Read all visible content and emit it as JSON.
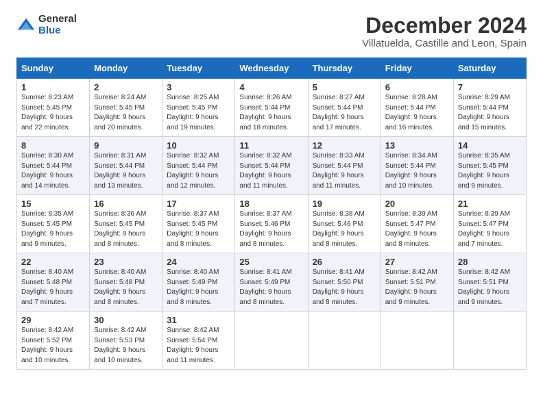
{
  "logo": {
    "general": "General",
    "blue": "Blue"
  },
  "title": "December 2024",
  "subtitle": "Villatuelda, Castille and Leon, Spain",
  "headers": [
    "Sunday",
    "Monday",
    "Tuesday",
    "Wednesday",
    "Thursday",
    "Friday",
    "Saturday"
  ],
  "weeks": [
    [
      {
        "day": "1",
        "sunrise": "Sunrise: 8:23 AM",
        "sunset": "Sunset: 5:45 PM",
        "daylight": "Daylight: 9 hours and 22 minutes."
      },
      {
        "day": "2",
        "sunrise": "Sunrise: 8:24 AM",
        "sunset": "Sunset: 5:45 PM",
        "daylight": "Daylight: 9 hours and 20 minutes."
      },
      {
        "day": "3",
        "sunrise": "Sunrise: 8:25 AM",
        "sunset": "Sunset: 5:45 PM",
        "daylight": "Daylight: 9 hours and 19 minutes."
      },
      {
        "day": "4",
        "sunrise": "Sunrise: 8:26 AM",
        "sunset": "Sunset: 5:44 PM",
        "daylight": "Daylight: 9 hours and 18 minutes."
      },
      {
        "day": "5",
        "sunrise": "Sunrise: 8:27 AM",
        "sunset": "Sunset: 5:44 PM",
        "daylight": "Daylight: 9 hours and 17 minutes."
      },
      {
        "day": "6",
        "sunrise": "Sunrise: 8:28 AM",
        "sunset": "Sunset: 5:44 PM",
        "daylight": "Daylight: 9 hours and 16 minutes."
      },
      {
        "day": "7",
        "sunrise": "Sunrise: 8:29 AM",
        "sunset": "Sunset: 5:44 PM",
        "daylight": "Daylight: 9 hours and 15 minutes."
      }
    ],
    [
      {
        "day": "8",
        "sunrise": "Sunrise: 8:30 AM",
        "sunset": "Sunset: 5:44 PM",
        "daylight": "Daylight: 9 hours and 14 minutes."
      },
      {
        "day": "9",
        "sunrise": "Sunrise: 8:31 AM",
        "sunset": "Sunset: 5:44 PM",
        "daylight": "Daylight: 9 hours and 13 minutes."
      },
      {
        "day": "10",
        "sunrise": "Sunrise: 8:32 AM",
        "sunset": "Sunset: 5:44 PM",
        "daylight": "Daylight: 9 hours and 12 minutes."
      },
      {
        "day": "11",
        "sunrise": "Sunrise: 8:32 AM",
        "sunset": "Sunset: 5:44 PM",
        "daylight": "Daylight: 9 hours and 11 minutes."
      },
      {
        "day": "12",
        "sunrise": "Sunrise: 8:33 AM",
        "sunset": "Sunset: 5:44 PM",
        "daylight": "Daylight: 9 hours and 11 minutes."
      },
      {
        "day": "13",
        "sunrise": "Sunrise: 8:34 AM",
        "sunset": "Sunset: 5:44 PM",
        "daylight": "Daylight: 9 hours and 10 minutes."
      },
      {
        "day": "14",
        "sunrise": "Sunrise: 8:35 AM",
        "sunset": "Sunset: 5:45 PM",
        "daylight": "Daylight: 9 hours and 9 minutes."
      }
    ],
    [
      {
        "day": "15",
        "sunrise": "Sunrise: 8:35 AM",
        "sunset": "Sunset: 5:45 PM",
        "daylight": "Daylight: 9 hours and 9 minutes."
      },
      {
        "day": "16",
        "sunrise": "Sunrise: 8:36 AM",
        "sunset": "Sunset: 5:45 PM",
        "daylight": "Daylight: 9 hours and 8 minutes."
      },
      {
        "day": "17",
        "sunrise": "Sunrise: 8:37 AM",
        "sunset": "Sunset: 5:45 PM",
        "daylight": "Daylight: 9 hours and 8 minutes."
      },
      {
        "day": "18",
        "sunrise": "Sunrise: 8:37 AM",
        "sunset": "Sunset: 5:46 PM",
        "daylight": "Daylight: 9 hours and 8 minutes."
      },
      {
        "day": "19",
        "sunrise": "Sunrise: 8:38 AM",
        "sunset": "Sunset: 5:46 PM",
        "daylight": "Daylight: 9 hours and 8 minutes."
      },
      {
        "day": "20",
        "sunrise": "Sunrise: 8:39 AM",
        "sunset": "Sunset: 5:47 PM",
        "daylight": "Daylight: 9 hours and 8 minutes."
      },
      {
        "day": "21",
        "sunrise": "Sunrise: 8:39 AM",
        "sunset": "Sunset: 5:47 PM",
        "daylight": "Daylight: 9 hours and 7 minutes."
      }
    ],
    [
      {
        "day": "22",
        "sunrise": "Sunrise: 8:40 AM",
        "sunset": "Sunset: 5:48 PM",
        "daylight": "Daylight: 9 hours and 7 minutes."
      },
      {
        "day": "23",
        "sunrise": "Sunrise: 8:40 AM",
        "sunset": "Sunset: 5:48 PM",
        "daylight": "Daylight: 9 hours and 8 minutes."
      },
      {
        "day": "24",
        "sunrise": "Sunrise: 8:40 AM",
        "sunset": "Sunset: 5:49 PM",
        "daylight": "Daylight: 9 hours and 8 minutes."
      },
      {
        "day": "25",
        "sunrise": "Sunrise: 8:41 AM",
        "sunset": "Sunset: 5:49 PM",
        "daylight": "Daylight: 9 hours and 8 minutes."
      },
      {
        "day": "26",
        "sunrise": "Sunrise: 8:41 AM",
        "sunset": "Sunset: 5:50 PM",
        "daylight": "Daylight: 9 hours and 8 minutes."
      },
      {
        "day": "27",
        "sunrise": "Sunrise: 8:42 AM",
        "sunset": "Sunset: 5:51 PM",
        "daylight": "Daylight: 9 hours and 9 minutes."
      },
      {
        "day": "28",
        "sunrise": "Sunrise: 8:42 AM",
        "sunset": "Sunset: 5:51 PM",
        "daylight": "Daylight: 9 hours and 9 minutes."
      }
    ],
    [
      {
        "day": "29",
        "sunrise": "Sunrise: 8:42 AM",
        "sunset": "Sunset: 5:52 PM",
        "daylight": "Daylight: 9 hours and 10 minutes."
      },
      {
        "day": "30",
        "sunrise": "Sunrise: 8:42 AM",
        "sunset": "Sunset: 5:53 PM",
        "daylight": "Daylight: 9 hours and 10 minutes."
      },
      {
        "day": "31",
        "sunrise": "Sunrise: 8:42 AM",
        "sunset": "Sunset: 5:54 PM",
        "daylight": "Daylight: 9 hours and 11 minutes."
      },
      null,
      null,
      null,
      null
    ]
  ]
}
